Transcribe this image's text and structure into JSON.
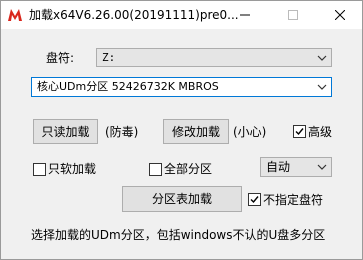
{
  "window": {
    "title": "加载x64V6.26.00(20191111)pre0..."
  },
  "drive": {
    "label": "盘符:",
    "value": "Z:"
  },
  "partition": {
    "selected": "核心UDm分区 52426732K MBROS"
  },
  "buttons": {
    "readonly_load": "只读加载",
    "readonly_note": "(防毒)",
    "modify_load": "修改加载",
    "modify_note": "(小心)",
    "partition_table_load": "分区表加载"
  },
  "options": {
    "advanced": {
      "label": "高级",
      "checked": true
    },
    "soft_load": {
      "label": "只软加载",
      "checked": false
    },
    "all_partitions": {
      "label": "全部分区",
      "checked": false
    },
    "no_drive_letter": {
      "label": "不指定盘符",
      "checked": true
    },
    "mode": {
      "value": "自动"
    }
  },
  "status": {
    "hint": "选择加载的UDm分区，包括windows不认的U盘多分区"
  },
  "colors": {
    "focus_border": "#0078d7",
    "window_bg": "#f0f0f0",
    "icon_red": "#d9261c"
  }
}
